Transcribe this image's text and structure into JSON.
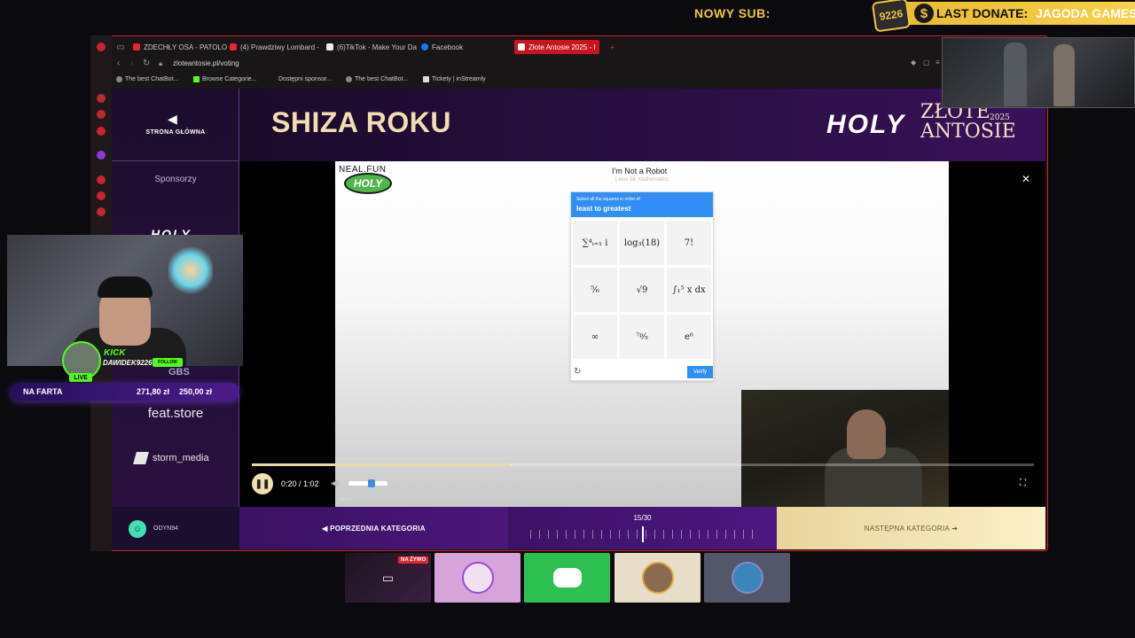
{
  "overlay": {
    "new_sub_label": "NOWY SUB:",
    "badge_text": "9226",
    "last_donate_label": "LAST DONATE:",
    "last_donate_name": "JAGODA GAMES"
  },
  "browser": {
    "tabs": [
      {
        "label": "ZDECHŁY OSA - PATOLO",
        "icon": "youtube-icon"
      },
      {
        "label": "(4) Prawdziwy Lombard -",
        "icon": "youtube-icon"
      },
      {
        "label": "(6)TikTok - Make Your Da",
        "icon": "tiktok-icon"
      },
      {
        "label": "Facebook",
        "icon": "facebook-icon"
      },
      {
        "label": "Złote Antosie 2025 - I",
        "icon": "site-icon"
      }
    ],
    "url": "zloteantosie.pl/voting",
    "bookmarks": [
      "The best ChatBot...",
      "Browse Categorie...",
      "Dostępni sponsor...",
      "The best ChatBot...",
      "Tickety | inStreamly"
    ]
  },
  "page": {
    "home_label": "STRONA GŁÓWNA",
    "sponsors_label": "Sponsorzy",
    "sponsors": [
      "HOLY",
      "GBS",
      "feat.store",
      "storm_media"
    ],
    "title": "SHIZA ROKU",
    "brand_holy": "HOLY",
    "brand_zlote": "ZŁOTE",
    "brand_antosie": "ANTOSIE",
    "brand_year": "2025"
  },
  "video": {
    "neal_label": "NEAL.FUN",
    "neal_badge": "HOLY",
    "captcha_title": "I'm Not a Robot",
    "captcha_subtitle": "Level 58: Mathematics",
    "captcha_prompt": "Select all the squares in order of",
    "captcha_prompt_bold": "least to greatest",
    "captcha_cells": [
      "∑⁴ᵢ₌₁ i",
      "log₃(18)",
      "7!",
      "⁵⁄₆",
      "√9",
      "∫₁⁵ x dx",
      "∞",
      "⁷ᵖ⁄₅",
      "e⁶"
    ],
    "verify_label": "Verify",
    "time": "0:20 / 1:02",
    "progress": 0.33,
    "volume": 0.6,
    "reset_label": "Reset"
  },
  "bottom_nav": {
    "user": "ODYN94",
    "prev_label": "POPRZEDNIA KATEGORIA",
    "counter": "15/30",
    "current": 15,
    "total": 30,
    "next_label": "NASTĘPNA KATEGORIA"
  },
  "stream": {
    "kick_label": "KICK",
    "kick_user": "DAWIDEK9226",
    "live_label": "LIVE",
    "follow_label": "FOLLOW",
    "goal_label": "NA FARTA",
    "goal_current": "271,80 zł",
    "goal_target": "250,00 zł",
    "live_now_badge": "NA ŻYWO"
  }
}
